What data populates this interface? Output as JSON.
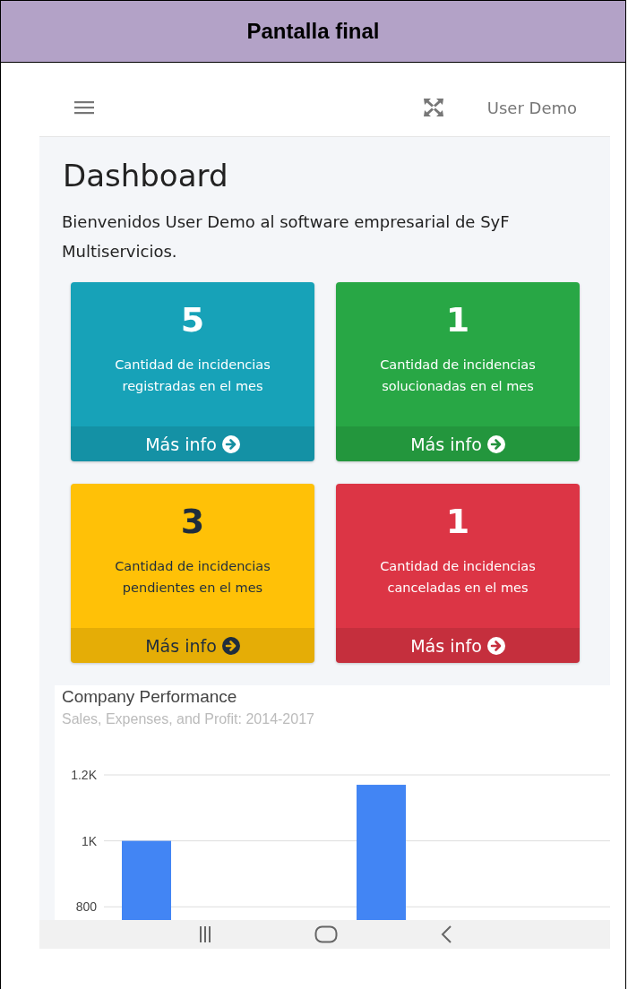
{
  "document": {
    "heading": "Pantalla final"
  },
  "topbar": {
    "user": "User Demo"
  },
  "page": {
    "title": "Dashboard",
    "welcome": "Bienvenidos User Demo al software empresarial de SyF Multiservicios."
  },
  "cards": [
    {
      "kind": "info",
      "value": "5",
      "label": "Cantidad de incidencias registradas en el mes",
      "link": "Más info"
    },
    {
      "kind": "success",
      "value": "1",
      "label": "Cantidad de incidencias solucionadas en el mes",
      "link": "Más info"
    },
    {
      "kind": "warning",
      "value": "3",
      "label": "Cantidad de incidencias pendientes en el mes",
      "link": "Más info"
    },
    {
      "kind": "danger",
      "value": "1",
      "label": "Cantidad de incidencias canceladas en el mes",
      "link": "Más info"
    }
  ],
  "chart": {
    "chart_data": {
      "type": "bar",
      "title": "Company Performance",
      "subtitle": "Sales, Expenses, and Profit: 2014-2017",
      "ylim": [
        760,
        1200
      ],
      "grid": true,
      "yticks": [
        {
          "value": 800,
          "label": "800"
        },
        {
          "value": 1000,
          "label": "1K"
        },
        {
          "value": 1200,
          "label": "1.2K"
        }
      ],
      "series": [
        {
          "color": "#4285f4",
          "values": [
            1000,
            1170
          ]
        }
      ]
    }
  }
}
